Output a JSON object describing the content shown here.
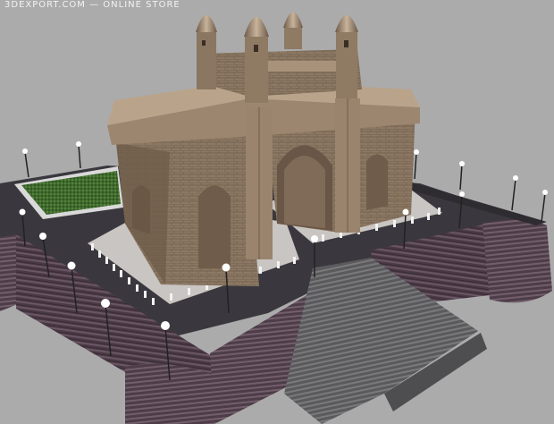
{
  "watermark": {
    "text": "3DEXPORT.COM — ONLINE STORE"
  },
  "colors": {
    "background": "#ababab",
    "stone": "#8a7560",
    "stone_dark": "#5e4e3f",
    "stone_light": "#b59f86",
    "platform": "#3c3a40",
    "wall_stripe_a": "#4a3a45",
    "wall_stripe_b": "#6a5664",
    "lawn": "#3f6a2e",
    "lamp": "#ffffff",
    "stairs": "#6e6e70"
  },
  "icons": {
    "monument": "gateway-arch-monument",
    "lamp": "street-lamp"
  }
}
